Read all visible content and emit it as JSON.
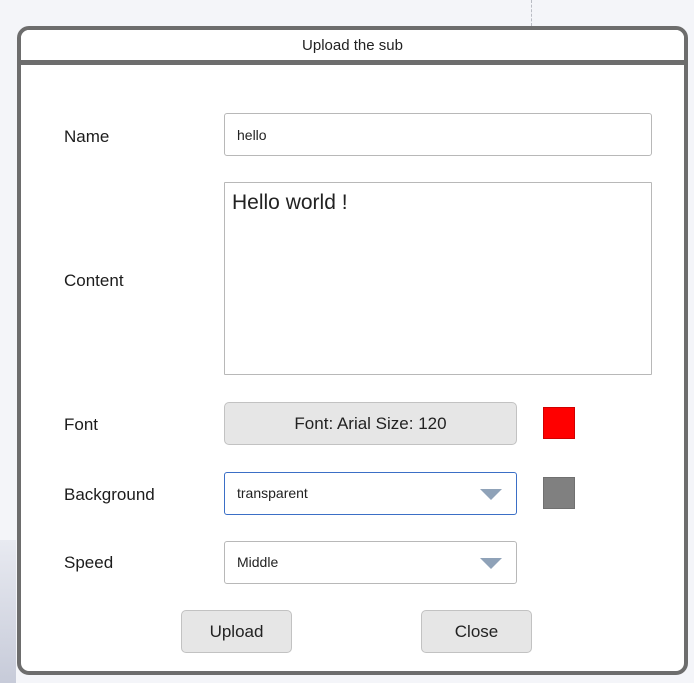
{
  "dialog": {
    "title": "Upload the sub"
  },
  "form": {
    "name_label": "Name",
    "name_value": "hello",
    "content_label": "Content",
    "content_value": "Hello world !",
    "font_label": "Font",
    "font_button_label": "Font:  Arial   Size:  120",
    "font_color": "#ff0000",
    "background_label": "Background",
    "background_value": "transparent",
    "background_color": "#808080",
    "speed_label": "Speed",
    "speed_value": "Middle"
  },
  "actions": {
    "upload_label": "Upload",
    "close_label": "Close"
  }
}
